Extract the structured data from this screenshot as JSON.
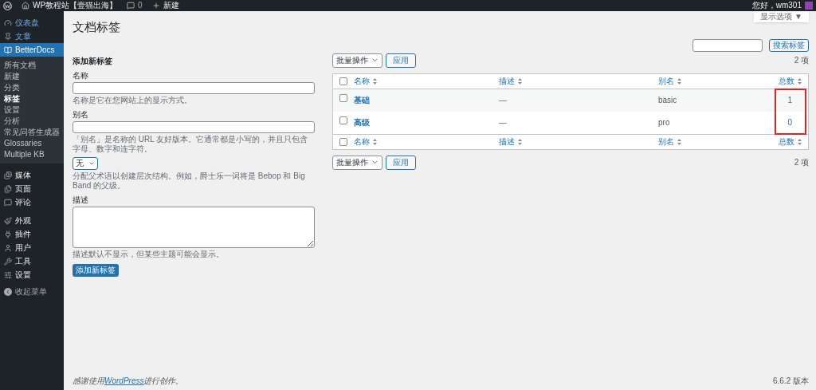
{
  "top_bar": {
    "site_name": "WP教程站【壹猫出海】",
    "comments_count": "0",
    "new_label": "新建",
    "greeting": "您好，wm301"
  },
  "screen_options": "显示选项 ▼",
  "sidebar": {
    "items": [
      {
        "label": "仪表盘",
        "selected": false
      },
      {
        "label": "文章",
        "selected": false
      },
      {
        "label": "BetterDocs",
        "selected": true,
        "children": [
          {
            "label": "所有文档",
            "selected": false
          },
          {
            "label": "新建",
            "selected": false
          },
          {
            "label": "分类",
            "selected": false
          },
          {
            "label": "标签",
            "selected": true
          },
          {
            "label": "设置",
            "selected": false
          },
          {
            "label": "分析",
            "selected": false
          },
          {
            "label": "常见问答生成器",
            "selected": false
          },
          {
            "label": "Glossaries",
            "selected": false
          },
          {
            "label": "Multiple KB",
            "selected": false
          }
        ]
      },
      {
        "label": "媒体",
        "selected": false
      },
      {
        "label": "页面",
        "selected": false
      },
      {
        "label": "评论",
        "selected": false
      },
      {
        "label": "外观",
        "selected": false
      },
      {
        "label": "插件",
        "selected": false
      },
      {
        "label": "用户",
        "selected": false
      },
      {
        "label": "工具",
        "selected": false
      },
      {
        "label": "设置",
        "selected": false
      }
    ],
    "collapse_label": "收起菜单"
  },
  "page_title": "文档标签",
  "search": {
    "button": "搜索标签"
  },
  "add_form": {
    "heading": "添加新标签",
    "fields": [
      {
        "kind": "input",
        "label": "名称",
        "hint": "名称是它在您网站上的显示方式。"
      },
      {
        "kind": "input",
        "label": "别名",
        "hint": "「别名」是名称的 URL 友好版本。它通常都是小写的，并且只包含字母、数字和连字符。"
      },
      {
        "kind": "select",
        "value": "无",
        "hint": "分配父术语以创建层次结构。例如，爵士乐一词将是 Bebop 和 Big Band 的父级。"
      },
      {
        "kind": "textarea",
        "label": "描述",
        "hint": "描述默认不显示，但某些主题可能会显示。"
      }
    ],
    "submit": "添加新标签"
  },
  "bulk_top": {
    "action": "批量操作",
    "apply": "应用",
    "count": "2 项"
  },
  "table": {
    "header": {
      "select_all_checked": false,
      "columns": [
        "名称",
        "描述",
        "别名",
        "总数"
      ]
    },
    "rows": [
      {
        "checked": false,
        "name": "基础",
        "description": "—",
        "slug": "basic",
        "count": "1"
      },
      {
        "checked": false,
        "name": "高级",
        "description": "—",
        "slug": "pro",
        "count": "0"
      }
    ],
    "footer": {
      "select_all_checked": false,
      "columns": [
        "名称",
        "描述",
        "别名",
        "总数"
      ]
    }
  },
  "bulk_bottom": {
    "action": "批量操作",
    "apply": "应用",
    "count": "2 项"
  },
  "footer": {
    "thanks_before": "感谢使用",
    "link": "WordPress",
    "thanks_after": "进行创作。",
    "version": "6.6.2 版本"
  }
}
